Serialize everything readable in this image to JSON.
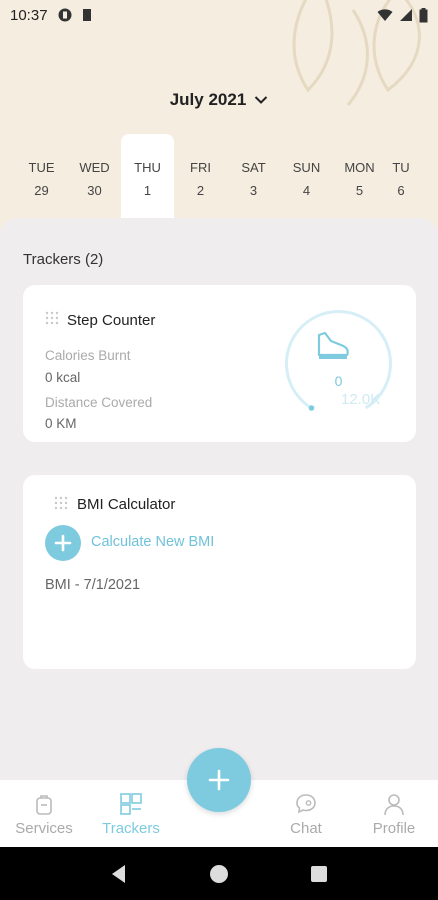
{
  "status": {
    "time": "10:37"
  },
  "header": {
    "month_label": "July 2021"
  },
  "days": [
    {
      "dow": "TUE",
      "num": "29"
    },
    {
      "dow": "WED",
      "num": "30"
    },
    {
      "dow": "THU",
      "num": "1",
      "selected": true
    },
    {
      "dow": "FRI",
      "num": "2"
    },
    {
      "dow": "SAT",
      "num": "3"
    },
    {
      "dow": "SUN",
      "num": "4"
    },
    {
      "dow": "MON",
      "num": "5"
    },
    {
      "dow": "TU",
      "num": "6"
    }
  ],
  "trackers": {
    "title": "Trackers (2)",
    "step_counter": {
      "title": "Step Counter",
      "calories_label": "Calories Burnt",
      "calories_value": "0 kcal",
      "distance_label": "Distance Covered",
      "distance_value": "0 KM",
      "steps_value": "0",
      "steps_goal": "12.0K",
      "progress": 0
    },
    "bmi": {
      "title": "BMI Calculator",
      "calculate_label": "Calculate New BMI",
      "entry": "BMI - 7/1/2021"
    }
  },
  "nav": {
    "services": "Services",
    "trackers": "Trackers",
    "chat": "Chat",
    "profile": "Profile"
  },
  "colors": {
    "accent": "#7ecbe0",
    "header_bg": "#f5ede0",
    "content_bg": "#efedee"
  }
}
